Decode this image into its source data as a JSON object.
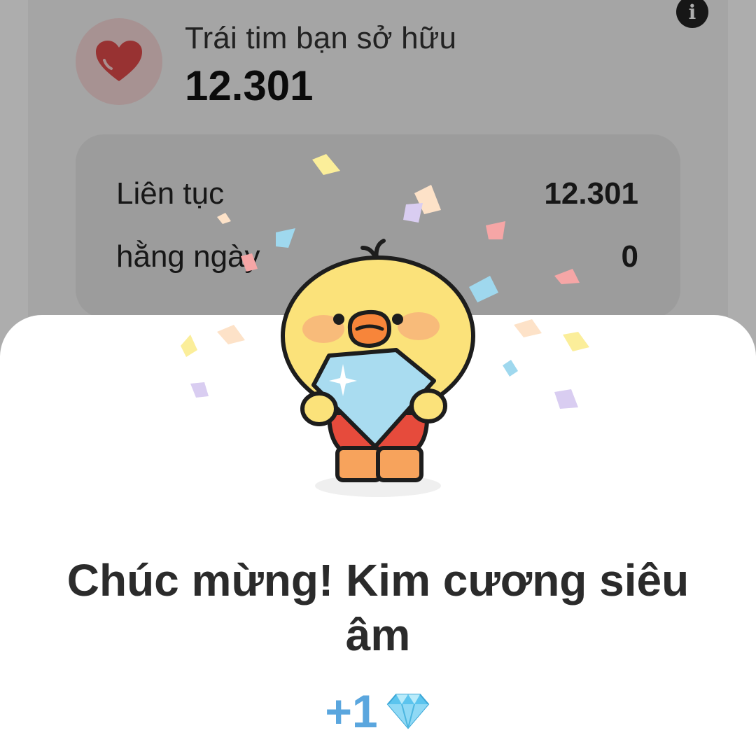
{
  "header": {
    "holdings_label": "Trái tim bạn sở hữu",
    "holdings_value": "12.301",
    "info_icon_glyph": "i"
  },
  "stats": [
    {
      "label": "Liên tục",
      "value": "12.301"
    },
    {
      "label": "hằng ngày",
      "value": "0"
    }
  ],
  "dialog": {
    "title": "Chúc mừng! Kim cương siêu âm",
    "reward_amount": "+1",
    "reward_icon": "diamond-icon"
  },
  "colors": {
    "heart": "#e04a4a",
    "accent_blue": "#5aa6de",
    "title_text": "#2b2b2b"
  }
}
